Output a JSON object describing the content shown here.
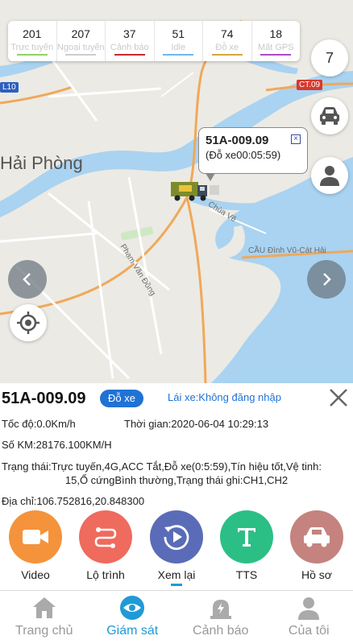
{
  "status_bar": [
    {
      "count": "201",
      "label": "Trực tuyến",
      "color": "#8dd16a"
    },
    {
      "count": "207",
      "label": "Ngoại tuyến",
      "color": "#cccccc"
    },
    {
      "count": "37",
      "label": "Cảnh báo",
      "color": "#c8282e"
    },
    {
      "count": "51",
      "label": "Idle",
      "color": "#6fb6f0"
    },
    {
      "count": "74",
      "label": "Đỗ xe",
      "color": "#d6a640"
    },
    {
      "count": "18",
      "label": "Mất GPS",
      "color": "#b049c8"
    }
  ],
  "map": {
    "count_button": "7",
    "city_label": "Hải Phòng",
    "shield_l10": "L10",
    "shield_ct09": "CT.09",
    "road_chua_ve": "Chùa Vẽ",
    "road_cau": "CẦU Đình Vũ-Cát Hải",
    "road_pvd": "Phạm Văn Đồng"
  },
  "popup": {
    "plate": "51A-009.09",
    "subtitle": "(Đỗ xe00:05:59)",
    "close": "×"
  },
  "vehicle": {
    "plate": "51A-009.09",
    "status": "Đỗ xe",
    "driver": "Lái xe:Không đăng nhập",
    "speed": "Tốc độ:0.0Km/h",
    "time": "Thời gian:2020-06-04 10:29:13",
    "km": "Số KM:28176.100KM/H",
    "state_line1": "Trạng thái:Trực tuyến,4G,ACC Tắt,Đỗ xe(0:5:59),Tín hiệu tốt,Vệ tinh:",
    "state_line2": "15,Ổ cứngBình thường,Trạng thái ghi:CH1,CH2",
    "address": "Địa chỉ:106.752816,20.848300"
  },
  "actions": [
    {
      "label": "Video",
      "color": "#f4933b",
      "icon": "video-camera-icon"
    },
    {
      "label": "Lộ trình",
      "color": "#ee6b5e",
      "icon": "route-icon"
    },
    {
      "label": "Xem lại",
      "color": "#5a6cb8",
      "icon": "replay-icon"
    },
    {
      "label": "TTS",
      "color": "#2bbf86",
      "icon": "text-t-icon"
    },
    {
      "label": "Hồ sơ",
      "color": "#c4837e",
      "icon": "car-profile-icon"
    }
  ],
  "bottom_nav": [
    {
      "label": "Trang chủ",
      "icon": "home-icon",
      "active": false
    },
    {
      "label": "Giám sát",
      "icon": "eye-icon",
      "active": true
    },
    {
      "label": "Cảnh báo",
      "icon": "alarm-icon",
      "active": false
    },
    {
      "label": "Của tôi",
      "icon": "user-icon",
      "active": false
    }
  ],
  "colors": {
    "accent": "#1f72d6",
    "nav_active": "#1f9ad6",
    "nav_inactive": "#999999",
    "water": "#a9d3f1"
  }
}
